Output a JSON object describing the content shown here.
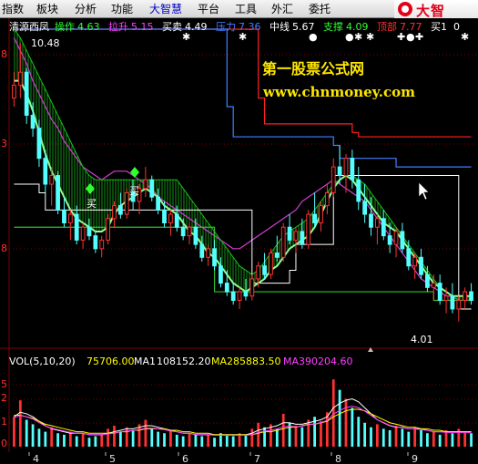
{
  "menu": [
    {
      "label": "指数"
    },
    {
      "label": "板块"
    },
    {
      "label": "分析"
    },
    {
      "label": "功能"
    },
    {
      "label": "大智慧",
      "active": true
    },
    {
      "label": "平台"
    },
    {
      "label": "工具"
    },
    {
      "label": "外汇"
    },
    {
      "label": "委托"
    }
  ],
  "brand": {
    "text": "大智",
    "color": "#e2001a"
  },
  "stock_name": "清源西凤",
  "indicators": [
    {
      "label": "操作",
      "value": "4.63",
      "color": "#30ff30"
    },
    {
      "label": "拉升",
      "value": "5.15",
      "color": "#ff40ff"
    },
    {
      "label": "买卖",
      "value": "4.49",
      "color": "#ffffff"
    },
    {
      "label": "压力",
      "value": "7.36",
      "color": "#4080ff"
    },
    {
      "label": "中线",
      "value": "5.67",
      "color": "#ffffff"
    },
    {
      "label": "支撑",
      "value": "4.09",
      "color": "#30ff30"
    },
    {
      "label": "顶部",
      "value": "7.77",
      "color": "#ff3030"
    },
    {
      "label": "买1",
      "value": "0",
      "color": "#ffffff"
    }
  ],
  "high_label": "10.48",
  "low_label": "4.01",
  "watermark": {
    "line1": "第一股票公式网",
    "line2": "www.chnmoney.com",
    "color": "#ffe600"
  },
  "buy_signal_label": "买",
  "price_axis_labels": [
    "8",
    "3",
    "8"
  ],
  "volume": {
    "title": "VOL(5,10,20)",
    "value": "75706.00",
    "ma1_label": "MA1",
    "ma1": "108152.20",
    "ma2_label": "MA2",
    "ma2": "85883.50",
    "ma3_label": "MA3",
    "ma3": "90204.60"
  },
  "volume_axis_labels": [
    "5",
    "2",
    "1",
    "0"
  ],
  "x_axis_labels": [
    "4",
    "5",
    "6",
    "7",
    "8",
    "9"
  ],
  "colors": {
    "up": "#ff3232",
    "down": "#54ffff",
    "background": "#000000",
    "grid": "#800000"
  },
  "chart_data": {
    "type": "candlestick",
    "candles": [
      [
        9.2,
        9.8,
        9.0,
        9.5
      ],
      [
        9.5,
        10.48,
        9.2,
        9.8
      ],
      [
        9.8,
        9.9,
        8.6,
        8.8
      ],
      [
        8.8,
        9.1,
        8.3,
        8.5
      ],
      [
        8.5,
        8.7,
        7.6,
        7.8
      ],
      [
        7.8,
        8.0,
        7.0,
        7.2
      ],
      [
        7.2,
        7.6,
        6.7,
        7.4
      ],
      [
        7.4,
        7.5,
        6.5,
        6.6
      ],
      [
        6.6,
        6.9,
        6.2,
        6.3
      ],
      [
        6.3,
        6.6,
        5.9,
        6.5
      ],
      [
        6.5,
        6.7,
        5.8,
        5.9
      ],
      [
        5.9,
        6.3,
        5.7,
        6.2
      ],
      [
        6.2,
        6.4,
        5.9,
        6.0
      ],
      [
        6.0,
        6.1,
        5.6,
        5.7
      ],
      [
        5.7,
        6.0,
        5.5,
        5.9
      ],
      [
        5.9,
        6.5,
        5.8,
        6.4
      ],
      [
        6.4,
        6.8,
        6.2,
        6.7
      ],
      [
        6.7,
        7.0,
        6.4,
        6.5
      ],
      [
        6.5,
        7.1,
        6.4,
        7.0
      ],
      [
        7.0,
        7.3,
        6.6,
        6.8
      ],
      [
        6.8,
        7.2,
        6.5,
        7.1
      ],
      [
        7.1,
        7.6,
        6.9,
        7.3
      ],
      [
        7.3,
        7.4,
        6.8,
        6.9
      ],
      [
        6.9,
        7.1,
        6.5,
        6.6
      ],
      [
        6.6,
        6.8,
        6.2,
        6.3
      ],
      [
        6.3,
        6.6,
        6.0,
        6.5
      ],
      [
        6.5,
        6.7,
        6.1,
        6.2
      ],
      [
        6.2,
        6.4,
        5.9,
        6.0
      ],
      [
        6.0,
        6.3,
        5.8,
        6.2
      ],
      [
        6.2,
        6.4,
        5.7,
        5.8
      ],
      [
        5.8,
        6.0,
        5.4,
        5.5
      ],
      [
        5.5,
        5.8,
        5.3,
        5.7
      ],
      [
        5.7,
        5.9,
        5.2,
        5.3
      ],
      [
        5.3,
        5.5,
        4.8,
        4.9
      ],
      [
        4.9,
        5.2,
        4.6,
        4.7
      ],
      [
        4.7,
        4.9,
        4.4,
        4.5
      ],
      [
        4.5,
        4.8,
        4.3,
        4.7
      ],
      [
        4.7,
        5.0,
        4.5,
        4.6
      ],
      [
        4.6,
        5.1,
        4.5,
        5.0
      ],
      [
        5.0,
        5.4,
        4.8,
        5.3
      ],
      [
        5.3,
        5.6,
        5.0,
        5.1
      ],
      [
        5.1,
        5.7,
        5.0,
        5.6
      ],
      [
        5.6,
        6.0,
        5.4,
        5.5
      ],
      [
        5.5,
        6.3,
        5.4,
        6.2
      ],
      [
        6.2,
        6.5,
        5.8,
        5.9
      ],
      [
        5.9,
        6.2,
        5.6,
        6.1
      ],
      [
        6.1,
        6.4,
        5.7,
        5.8
      ],
      [
        5.8,
        6.6,
        5.7,
        6.5
      ],
      [
        6.5,
        7.0,
        6.2,
        6.3
      ],
      [
        6.3,
        6.8,
        6.1,
        6.7
      ],
      [
        6.7,
        7.2,
        6.5,
        7.0
      ],
      [
        7.0,
        7.8,
        6.9,
        7.6
      ],
      [
        7.6,
        8.1,
        7.2,
        7.4
      ],
      [
        7.4,
        7.9,
        7.0,
        7.8
      ],
      [
        7.8,
        8.0,
        7.1,
        7.3
      ],
      [
        7.3,
        7.6,
        6.6,
        6.8
      ],
      [
        6.8,
        7.2,
        6.3,
        6.5
      ],
      [
        6.5,
        6.9,
        6.0,
        6.2
      ],
      [
        6.2,
        6.5,
        5.8,
        6.4
      ],
      [
        6.4,
        6.6,
        5.9,
        6.0
      ],
      [
        6.0,
        6.3,
        5.6,
        5.8
      ],
      [
        5.8,
        6.2,
        5.5,
        6.1
      ],
      [
        6.1,
        6.3,
        5.6,
        5.7
      ],
      [
        5.7,
        5.9,
        5.2,
        5.3
      ],
      [
        5.3,
        5.6,
        5.0,
        5.5
      ],
      [
        5.5,
        5.7,
        5.0,
        5.1
      ],
      [
        5.1,
        5.3,
        4.7,
        4.8
      ],
      [
        4.8,
        5.1,
        4.5,
        4.9
      ],
      [
        4.9,
        5.1,
        4.4,
        4.5
      ],
      [
        4.5,
        4.8,
        4.2,
        4.6
      ],
      [
        4.6,
        4.9,
        4.2,
        4.3
      ],
      [
        4.3,
        4.6,
        4.01,
        4.5
      ],
      [
        4.5,
        4.8,
        4.3,
        4.7
      ],
      [
        4.7,
        4.9,
        4.4,
        4.5
      ]
    ],
    "volume_range": [
      0,
      5
    ],
    "volume": [
      2.0,
      3.1,
      1.8,
      1.5,
      1.2,
      1.0,
      1.3,
      0.9,
      0.8,
      1.0,
      0.7,
      0.9,
      0.6,
      0.7,
      0.8,
      1.2,
      1.4,
      1.0,
      1.3,
      1.1,
      1.5,
      1.8,
      1.2,
      1.0,
      0.9,
      1.1,
      0.8,
      0.7,
      0.9,
      0.8,
      0.7,
      0.8,
      0.6,
      0.9,
      0.8,
      0.7,
      0.9,
      0.8,
      1.2,
      1.6,
      1.3,
      1.5,
      1.2,
      2.2,
      1.6,
      1.4,
      1.3,
      1.8,
      2.0,
      1.7,
      2.3,
      4.5,
      3.8,
      3.2,
      2.6,
      2.0,
      1.6,
      1.3,
      1.5,
      1.2,
      1.1,
      1.4,
      1.2,
      1.0,
      1.3,
      1.1,
      0.9,
      1.0,
      0.8,
      1.1,
      0.9,
      1.2,
      1.0,
      0.9
    ],
    "y_range": [
      3.6,
      10.8
    ],
    "upper_band": [
      10.8,
      10.6,
      10.3,
      10.0,
      9.7,
      9.4,
      9.1,
      8.8,
      8.5,
      8.2,
      7.9,
      7.6,
      7.4,
      7.3,
      7.3,
      7.3,
      7.3,
      7.3,
      7.3,
      7.3,
      7.3,
      7.3,
      7.3,
      7.3,
      7.3,
      7.3,
      7.3,
      7.1,
      6.9,
      6.7,
      6.5,
      6.3,
      6.1,
      5.9,
      5.7,
      5.5,
      5.3,
      5.2,
      5.1,
      5.2,
      5.4,
      5.6,
      5.8,
      6.0,
      6.1,
      6.2,
      6.3,
      6.4,
      6.6,
      6.8,
      7.0,
      7.2,
      7.3,
      7.4,
      7.4,
      7.3,
      7.2,
      7.0,
      6.8,
      6.6,
      6.4,
      6.2,
      6.0,
      5.8,
      5.6,
      5.4,
      5.2,
      5.0,
      4.8,
      4.7,
      4.6,
      4.5,
      4.5,
      4.5
    ],
    "mid_line": [
      9.6,
      9.6,
      9.3,
      8.9,
      8.4,
      7.9,
      7.5,
      7.2,
      6.9,
      6.6,
      6.4,
      6.3,
      6.2,
      6.1,
      6.1,
      6.2,
      6.5,
      6.7,
      6.8,
      6.9,
      7.0,
      7.1,
      7.0,
      6.9,
      6.7,
      6.6,
      6.5,
      6.3,
      6.1,
      6.0,
      5.8,
      5.6,
      5.5,
      5.3,
      5.1,
      4.9,
      4.8,
      4.7,
      4.8,
      4.9,
      5.0,
      5.2,
      5.3,
      5.5,
      5.7,
      5.8,
      5.9,
      6.0,
      6.2,
      6.5,
      6.8,
      7.1,
      7.3,
      7.4,
      7.3,
      7.1,
      6.9,
      6.7,
      6.5,
      6.3,
      6.2,
      6.1,
      5.9,
      5.7,
      5.5,
      5.3,
      5.1,
      4.9,
      4.8,
      4.7,
      4.6,
      4.6,
      4.6,
      4.6
    ],
    "resistance": [
      10.8,
      10.8,
      10.8,
      10.8,
      10.8,
      10.8,
      10.8,
      10.8,
      10.8,
      10.8,
      10.8,
      10.8,
      10.8,
      10.8,
      10.8,
      10.8,
      10.8,
      10.8,
      10.8,
      10.8,
      10.8,
      10.8,
      10.8,
      10.8,
      10.8,
      10.8,
      10.8,
      10.8,
      10.8,
      10.8,
      10.8,
      10.8,
      10.8,
      10.8,
      9.0,
      8.3,
      8.3,
      8.3,
      8.3,
      8.3,
      8.3,
      8.3,
      8.3,
      8.3,
      8.3,
      8.3,
      8.3,
      8.3,
      8.3,
      8.3,
      8.3,
      8.1,
      7.8,
      7.8,
      7.8,
      7.8,
      7.8,
      7.8,
      7.8,
      7.8,
      7.8,
      7.6,
      7.6,
      7.6,
      7.6,
      7.6,
      7.6,
      7.6,
      7.6,
      7.6,
      7.6,
      7.6,
      7.6,
      7.6
    ],
    "top_line": [
      10.8,
      10.8,
      10.8,
      10.8,
      10.8,
      10.8,
      10.8,
      10.8,
      10.8,
      10.8,
      10.8,
      10.8,
      10.8,
      10.8,
      10.8,
      10.8,
      10.8,
      10.8,
      10.8,
      10.8,
      10.8,
      10.8,
      10.8,
      10.8,
      10.8,
      10.8,
      10.8,
      10.8,
      10.8,
      10.8,
      10.8,
      10.8,
      10.8,
      10.8,
      10.8,
      10.8,
      10.8,
      10.8,
      10.8,
      9.2,
      8.6,
      8.6,
      8.6,
      8.6,
      8.6,
      8.6,
      8.6,
      8.6,
      8.6,
      8.6,
      8.6,
      8.6,
      8.6,
      8.6,
      8.4,
      8.3,
      8.3,
      8.3,
      8.3,
      8.3,
      8.3,
      8.3,
      8.3,
      8.3,
      8.3,
      8.3,
      8.3,
      8.3,
      8.3,
      8.3,
      8.3,
      8.3,
      8.3,
      8.3
    ],
    "magenta_line": [
      10.6,
      10.3,
      10.0,
      9.6,
      9.3,
      9.0,
      8.7,
      8.5,
      8.2,
      8.0,
      7.8,
      7.6,
      7.5,
      7.4,
      7.3,
      7.4,
      7.5,
      7.5,
      7.5,
      7.4,
      7.3,
      7.2,
      7.1,
      6.9,
      6.8,
      6.7,
      6.6,
      6.5,
      6.4,
      6.3,
      6.2,
      6.1,
      6.0,
      5.9,
      5.8,
      5.7,
      5.7,
      5.8,
      5.9,
      6.0,
      6.1,
      6.2,
      6.3,
      6.4,
      6.5,
      6.6,
      6.8,
      6.9,
      7.0,
      7.1,
      7.2,
      7.3,
      7.2,
      7.1,
      7.0,
      6.9,
      6.8,
      6.6,
      6.4,
      6.2,
      6.0,
      5.8,
      5.6,
      5.4,
      5.2,
      5.0,
      4.9,
      4.8,
      4.7,
      4.6,
      4.6,
      4.5,
      4.5,
      4.5
    ],
    "support": [
      6.2,
      6.2,
      6.2,
      6.2,
      6.2,
      6.2,
      6.2,
      6.2,
      6.2,
      6.2,
      6.2,
      6.2,
      6.2,
      6.2,
      6.2,
      6.2,
      6.2,
      6.2,
      6.2,
      6.2,
      6.2,
      6.2,
      6.2,
      6.2,
      6.2,
      6.2,
      6.2,
      6.2,
      6.2,
      6.2,
      6.2,
      6.2,
      4.7,
      4.7,
      4.7,
      4.7,
      4.7,
      4.7,
      4.7,
      4.7,
      4.7,
      4.7,
      4.7,
      4.7,
      4.7,
      4.7,
      4.7,
      4.7,
      4.7,
      4.7,
      4.7,
      4.7,
      4.7,
      4.7,
      4.7,
      4.7,
      4.7,
      4.7,
      4.7,
      4.7,
      4.7,
      4.7,
      4.7,
      4.7,
      4.7,
      4.7,
      4.7,
      4.5,
      4.5,
      4.5,
      4.5,
      4.3,
      4.3,
      4.3
    ],
    "buy_sell_line": [
      7.2,
      7.2,
      7.2,
      7.2,
      7.0,
      6.6,
      6.6,
      6.6,
      6.6,
      6.6,
      6.6,
      6.6,
      6.6,
      6.6,
      6.6,
      6.6,
      6.6,
      6.6,
      6.6,
      6.6,
      6.6,
      6.6,
      6.6,
      6.6,
      6.6,
      6.6,
      6.6,
      6.6,
      6.6,
      6.6,
      6.6,
      6.6,
      6.6,
      6.6,
      6.6,
      6.6,
      6.6,
      6.6,
      4.9,
      4.9,
      4.9,
      4.9,
      4.9,
      4.9,
      5.2,
      5.8,
      5.8,
      5.8,
      5.8,
      5.8,
      5.8,
      7.4,
      7.4,
      7.4,
      7.4,
      7.4,
      7.4,
      7.4,
      7.4,
      7.4,
      7.4,
      7.4,
      7.4,
      7.4,
      7.4,
      7.4,
      7.4,
      7.4,
      7.4,
      7.4,
      7.4,
      4.3,
      4.3,
      4.3
    ],
    "vol_ma": [
      2.0,
      2.3,
      2.2,
      2.0,
      1.7,
      1.4,
      1.2,
      1.1,
      1.0,
      0.9,
      0.9,
      0.9,
      0.8,
      0.8,
      0.8,
      0.9,
      1.0,
      1.1,
      1.2,
      1.2,
      1.3,
      1.4,
      1.4,
      1.3,
      1.2,
      1.1,
      1.0,
      0.9,
      0.9,
      0.8,
      0.8,
      0.8,
      0.8,
      0.8,
      0.8,
      0.8,
      0.8,
      0.8,
      0.9,
      1.1,
      1.2,
      1.3,
      1.4,
      1.6,
      1.6,
      1.5,
      1.5,
      1.6,
      1.7,
      1.8,
      2.0,
      2.6,
      2.9,
      3.1,
      3.2,
      3.0,
      2.6,
      2.2,
      1.8,
      1.6,
      1.4,
      1.3,
      1.3,
      1.2,
      1.2,
      1.2,
      1.1,
      1.0,
      1.0,
      1.0,
      1.0,
      1.0,
      1.0,
      1.0
    ],
    "vol_ma2": [
      2.1,
      2.1,
      2.0,
      1.9,
      1.7,
      1.5,
      1.4,
      1.3,
      1.2,
      1.1,
      1.0,
      1.0,
      0.9,
      0.9,
      0.9,
      0.9,
      0.9,
      1.0,
      1.0,
      1.1,
      1.1,
      1.2,
      1.2,
      1.2,
      1.2,
      1.1,
      1.1,
      1.0,
      1.0,
      0.9,
      0.9,
      0.9,
      0.8,
      0.8,
      0.8,
      0.8,
      0.8,
      0.8,
      0.8,
      0.9,
      1.0,
      1.0,
      1.1,
      1.2,
      1.3,
      1.3,
      1.4,
      1.5,
      1.5,
      1.6,
      1.7,
      2.0,
      2.2,
      2.4,
      2.5,
      2.5,
      2.4,
      2.2,
      2.0,
      1.8,
      1.6,
      1.5,
      1.4,
      1.3,
      1.3,
      1.2,
      1.2,
      1.1,
      1.1,
      1.0,
      1.0,
      1.0,
      1.0,
      1.0
    ]
  }
}
